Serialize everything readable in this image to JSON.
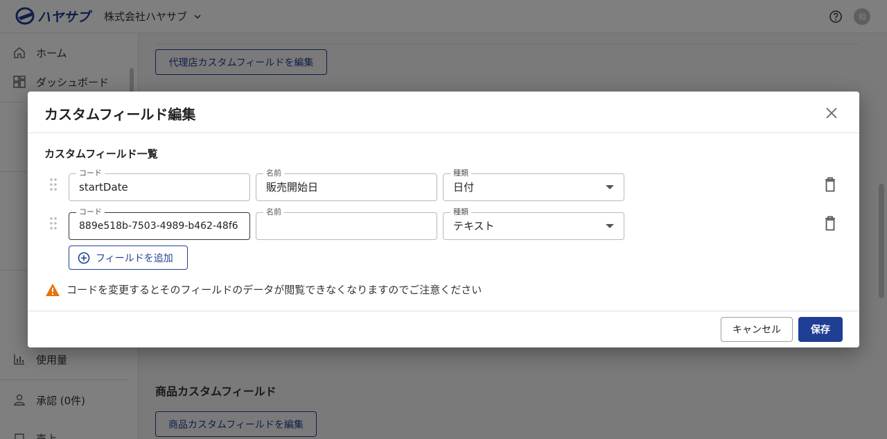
{
  "app": {
    "logo_text": "ハヤサブ",
    "company_name": "株式会社ハヤサブ",
    "avatar_initial": "相"
  },
  "sidebar": {
    "items": [
      {
        "label": "ホーム",
        "icon": "home-icon"
      },
      {
        "label": "ダッシュボード",
        "icon": "dashboard-icon"
      },
      {
        "label": "使用量",
        "icon": "bar-chart-icon"
      },
      {
        "label": "承認 (0件)",
        "icon": "person-icon"
      },
      {
        "label": "売上",
        "icon": "sales-icon"
      }
    ]
  },
  "background": {
    "agency_edit_button": "代理店カスタムフィールドを編集",
    "product_section_title": "商品カスタムフィールド",
    "product_edit_button": "商品カスタムフィールドを編集"
  },
  "dialog": {
    "title": "カスタムフィールド編集",
    "list_title": "カスタムフィールド一覧",
    "labels": {
      "code": "コード",
      "name": "名前",
      "type": "種類"
    },
    "rows": [
      {
        "code": "startDate",
        "name": "販売開始日",
        "type": "日付"
      },
      {
        "code": "889e518b-7503-4989-b462-48f6",
        "name": "",
        "type": "テキスト"
      }
    ],
    "add_button": "フィールドを追加",
    "warning": "コードを変更するとそのフィールドのデータが閲覧できなくなりますのでご注意ください",
    "cancel_button": "キャンセル",
    "save_button": "保存"
  },
  "colors": {
    "brand": "#1f3f95",
    "warning": "#e8710a",
    "overlay": "rgba(0,0,0,0.5)"
  }
}
